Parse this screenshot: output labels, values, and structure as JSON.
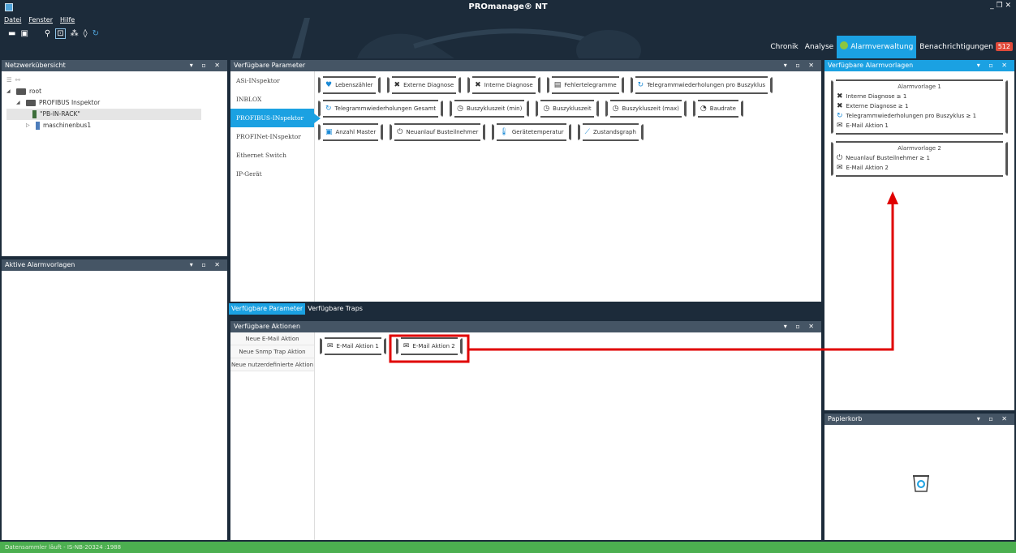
{
  "app": {
    "title": "PROmanage® NT",
    "window_controls": "_ ❐ ✕"
  },
  "menu": [
    "Datei",
    "Fenster",
    "Hilfe"
  ],
  "toolbar_icons": [
    "open-folder-icon",
    "save-icon",
    "search-icon",
    "select-icon",
    "network-icon",
    "location-icon",
    "refresh-icon"
  ],
  "views": {
    "chronik": "Chronik",
    "analyse": "Analyse",
    "alarmverwaltung": "Alarmverwaltung",
    "benachrichtigungen": "Benachrichtigungen",
    "badge": "512"
  },
  "network_overview": {
    "title": "Netzwerkübersicht",
    "tree": {
      "root": "root",
      "inspector": "PROFIBUS Inspektor",
      "device": "\"PB-IN-RACK\"",
      "bus": "maschinenbus1"
    }
  },
  "active_alarm_templates": {
    "title": "Aktive Alarmvorlagen"
  },
  "available_parameters": {
    "title": "Verfügbare Parameter",
    "tabs": [
      "ASi-INspektor",
      "INBLOX",
      "PROFIBUS-INspektor",
      "PROFINet-INspektor",
      "Ethernet Switch",
      "IP-Gerät"
    ],
    "rows": [
      [
        "Lebenszähler",
        "Externe Diagnose",
        "Interne Diagnose",
        "Fehlertelegramme",
        "Telegrammwiederholungen pro Buszyklus"
      ],
      [
        "Telegrammwiederholungen Gesamt",
        "Buszykluszeit (min)",
        "Buszykluszeit",
        "Buszykluszeit (max)",
        "Baudrate"
      ],
      [
        "Anzahl Master",
        "Neuanlauf Busteilnehmer",
        "Gerätetemperatur",
        "Zustandsgraph"
      ]
    ]
  },
  "bottom_tabs": {
    "params": "Verfügbare Parameter",
    "traps": "Verfügbare Traps"
  },
  "available_actions": {
    "title": "Verfügbare Aktionen",
    "new_email": "Neue E-Mail Aktion",
    "new_snmp": "Neue Snmp Trap Aktion",
    "new_custom": "Neue nutzerdefinierte Aktion",
    "actions": [
      "E-Mail Aktion 1",
      "E-Mail Aktion 2"
    ]
  },
  "alarm_templates": {
    "title": "Verfügbare Alarmvorlagen",
    "t1": {
      "title": "Alarmvorlage 1",
      "l1": "Interne Diagnose  ≥  1",
      "l2": "Externe Diagnose  ≥  1",
      "l3": "Telegrammwiederholungen pro Buszyklus  ≥  1",
      "l4": "E-Mail Aktion 1"
    },
    "t2": {
      "title": "Alarmvorlage 2",
      "l1": "Neuanlauf Busteilnehmer  ≥  1",
      "l2": "E-Mail Aktion 2"
    }
  },
  "trash": {
    "title": "Papierkorb"
  },
  "status": "Datensammler läuft - IS-NB-20324 :1988",
  "colors": {
    "accent": "#1ba1e2",
    "highlight": "#e00000",
    "status_bar": "#4caf50",
    "badge": "#e04a3a"
  }
}
